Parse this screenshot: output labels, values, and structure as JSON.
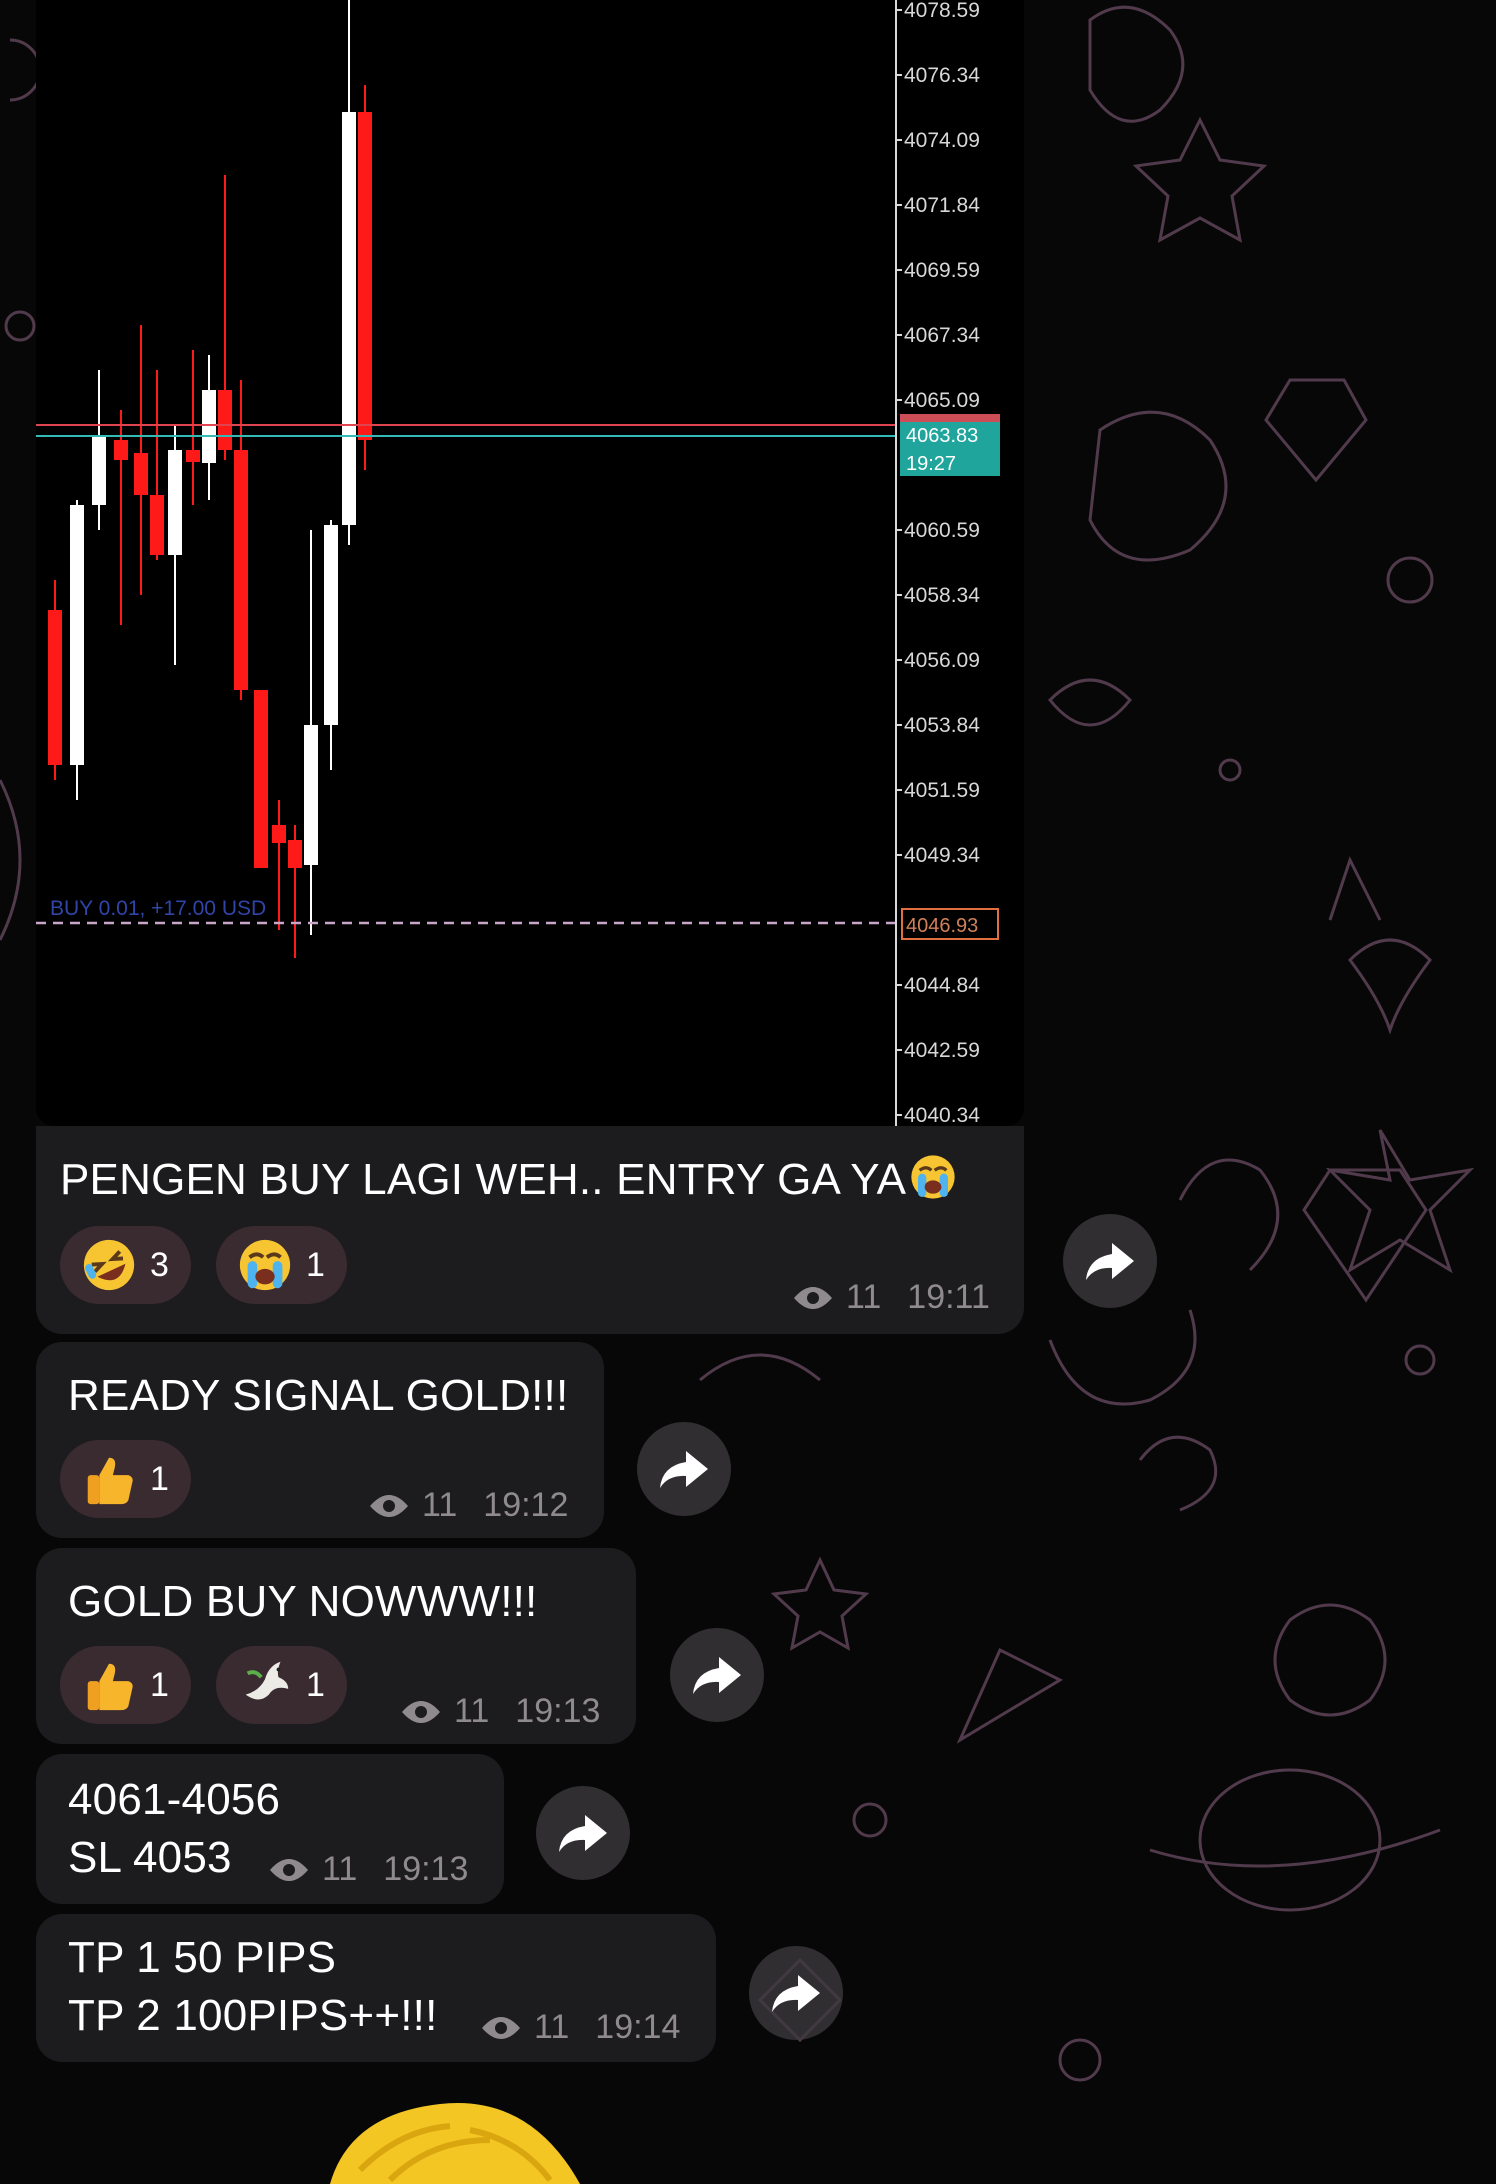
{
  "chart": {
    "price_labels": [
      "4078.59",
      "4076.34",
      "4074.09",
      "4071.84",
      "4069.59",
      "4067.34",
      "4065.09",
      "4060.59",
      "4058.34",
      "4056.09",
      "4053.84",
      "4051.59",
      "4049.34",
      "4044.84",
      "4042.59",
      "4040.34"
    ],
    "current_price": "4063.83",
    "current_time": "19:27",
    "position_price": "4046.93",
    "position_label": "BUY 0.01,  +17.00 USD",
    "colors": {
      "bull": "#ffffff",
      "bear": "#ff1a1a",
      "bid_line": "#e0454f",
      "ask_line": "#35b9b4",
      "position_line": "#c8a6c7",
      "price_tag_bg": "#1fa59b",
      "position_tag_border": "#e07040"
    }
  },
  "messages": [
    {
      "text": "PENGEN BUY LAGI WEH.. ENTRY GA YA",
      "trailing_emoji": "loudly-crying-face",
      "reactions": [
        {
          "emoji": "rolling-on-floor-laughing",
          "count": "3"
        },
        {
          "emoji": "loudly-crying-face",
          "count": "1"
        }
      ],
      "views": "11",
      "time": "19:11"
    },
    {
      "text": "READY SIGNAL GOLD!!!",
      "reactions": [
        {
          "emoji": "thumbs-up",
          "count": "1"
        }
      ],
      "views": "11",
      "time": "19:12"
    },
    {
      "text": "GOLD BUY NOWWW!!!",
      "reactions": [
        {
          "emoji": "thumbs-up",
          "count": "1"
        },
        {
          "emoji": "dove",
          "count": "1"
        }
      ],
      "views": "11",
      "time": "19:13"
    },
    {
      "lines": [
        "4061-4056",
        "SL 4053"
      ],
      "views": "11",
      "time": "19:13"
    },
    {
      "lines": [
        "TP 1 50 PIPS",
        "TP 2 100PIPS++!!!"
      ],
      "views": "11",
      "time": "19:14"
    }
  ],
  "icons": {
    "forward": "forward-arrow-icon",
    "views": "eye-icon"
  },
  "theme": {
    "bubble_bg": "#1c1b1d",
    "reaction_bg": "#3a2b30",
    "meta_color": "#8f8a8d",
    "doodle_color": "#6e4f6a"
  }
}
